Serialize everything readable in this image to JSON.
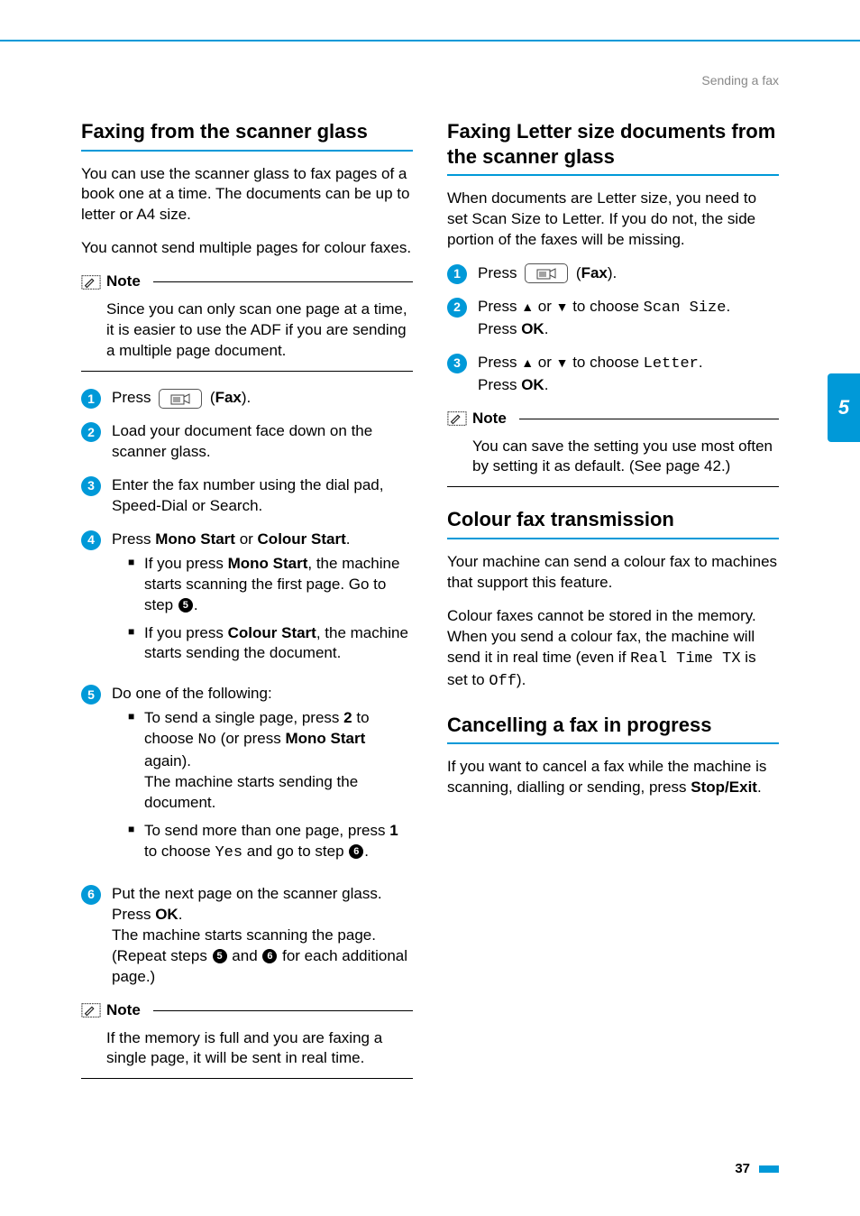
{
  "header": {
    "breadcrumb": "Sending a fax"
  },
  "side_tab": "5",
  "page_number": "37",
  "left": {
    "h1": "Faxing from the scanner glass",
    "p1": "You can use the scanner glass to fax pages of a book one at a time. The documents can be up to letter or A4 size.",
    "p2": "You cannot send multiple pages for colour faxes.",
    "note1_title": "Note",
    "note1_body": "Since you can only scan one page at a time, it is easier to use the ADF if you are sending a multiple page document.",
    "step1_pre": "Press ",
    "step1_post": " (",
    "step1_fax": "Fax",
    "step1_end": ").",
    "step2": "Load your document face down on the scanner glass.",
    "step3": "Enter the fax number using the dial pad, Speed-Dial or Search.",
    "step4_line": "Press ",
    "step4_mono": "Mono Start",
    "step4_or": " or ",
    "step4_colour": "Colour Start",
    "step4_dot": ".",
    "step4_a_pre": "If you press ",
    "step4_a_b": "Mono Start",
    "step4_a_post1": ", the machine starts scanning the first page. Go to step ",
    "step4_a_post2": ".",
    "step4_b_pre": "If you press ",
    "step4_b_b": "Colour Start",
    "step4_b_post": ", the machine starts sending the document.",
    "step5_line": "Do one of the following:",
    "step5_a_pre": "To send a single page, press ",
    "step5_a_b": "2",
    "step5_a_mid": " to choose ",
    "step5_a_mono": "No",
    "step5_a_mid2": " (or press ",
    "step5_a_b2": "Mono Start",
    "step5_a_post": " again).",
    "step5_a_line2": "The machine starts sending the document.",
    "step5_b_pre": "To send more than one page, press ",
    "step5_b_b": "1",
    "step5_b_mid": " to choose ",
    "step5_b_mono": "Yes",
    "step5_b_mid2": " and go to step ",
    "step5_b_post": ".",
    "step6_l1": "Put the next page on the scanner glass.",
    "step6_l2a": "Press ",
    "step6_l2b": "OK",
    "step6_l2c": ".",
    "step6_l3": "The machine starts scanning the page.",
    "step6_l4a": "(Repeat steps ",
    "step6_l4b": " and ",
    "step6_l4c": " for each additional page.)",
    "note2_title": "Note",
    "note2_body": "If the memory is full and you are faxing a single page, it will be sent in real time."
  },
  "right": {
    "h1": "Faxing Letter size documents from the scanner glass",
    "p1": "When documents are Letter size, you need to set Scan Size to Letter. If you do not, the side portion of the faxes will be missing.",
    "r_step1_pre": "Press ",
    "r_step1_post": " (",
    "r_step1_fax": "Fax",
    "r_step1_end": ").",
    "r_step2_a": "Press ",
    "r_step2_b": " or ",
    "r_step2_c": " to choose ",
    "r_step2_mono": "Scan Size",
    "r_step2_d": ".",
    "r_step2_e": "Press ",
    "r_step2_ok": "OK",
    "r_step2_f": ".",
    "r_step3_a": "Press ",
    "r_step3_b": " or ",
    "r_step3_c": " to choose ",
    "r_step3_mono": "Letter",
    "r_step3_d": ".",
    "r_step3_e": "Press ",
    "r_step3_ok": "OK",
    "r_step3_f": ".",
    "note1_title": "Note",
    "note1_body": "You can save the setting you use most often by setting it as default. (See page 42.)",
    "h2": "Colour fax transmission",
    "h2_p1": "Your machine can send a colour fax to machines that support this feature.",
    "h2_p2a": "Colour faxes cannot be stored in the memory. When you send a colour fax, the machine will send it in real time (even if ",
    "h2_p2_mono1": "Real Time TX",
    "h2_p2b": " is set to ",
    "h2_p2_mono2": "Off",
    "h2_p2c": ").",
    "h3": "Cancelling a fax in progress",
    "h3_p1a": "If you want to cancel a fax while the machine is scanning, dialling or sending, press ",
    "h3_p1b": "Stop/Exit",
    "h3_p1c": "."
  }
}
